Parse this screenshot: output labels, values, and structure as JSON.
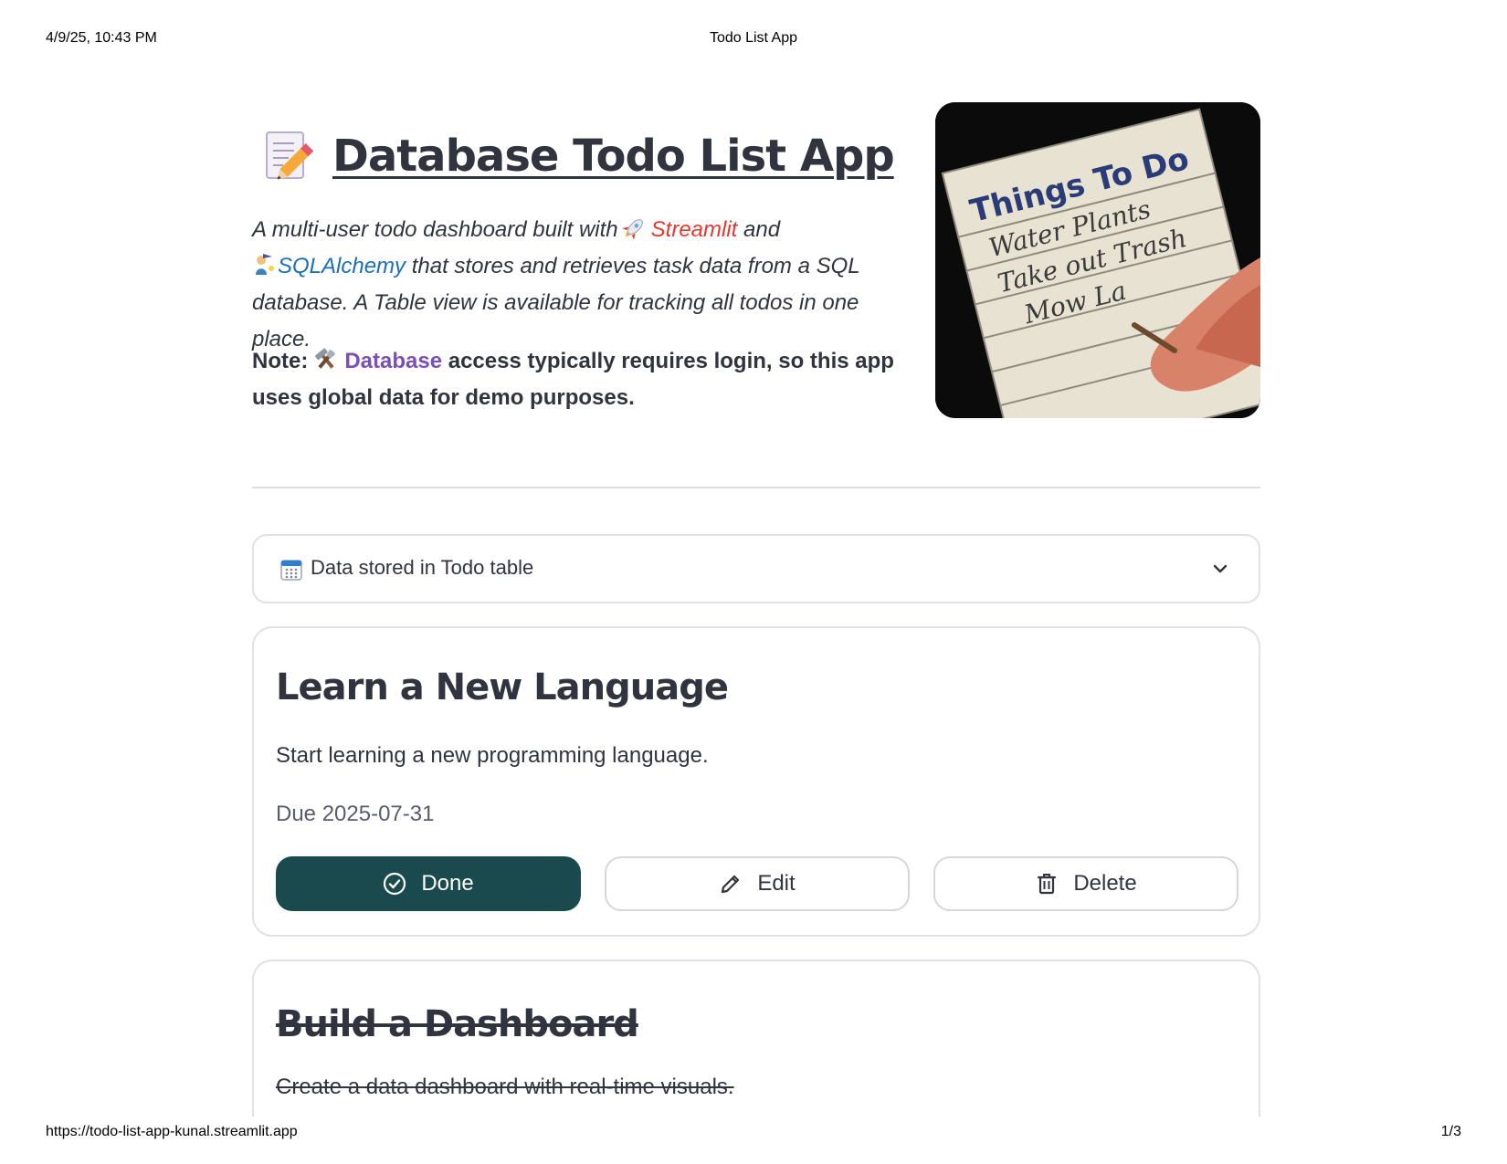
{
  "print": {
    "datetime": "4/9/25, 10:43 PM",
    "page_title": "Todo List App",
    "url": "https://todo-list-app-kunal.streamlit.app",
    "page_number": "1/3"
  },
  "header": {
    "title": "Database Todo List App",
    "title_icon": "memo-icon",
    "subtitle": {
      "part1": "A multi-user todo dashboard built with",
      "streamlit_link": "Streamlit",
      "and": "and",
      "sqlalchemy_link": "SQLAlchemy",
      "part2": "that stores and retrieves task data from a SQL database. A Table view is available for tracking all todos in one place."
    },
    "note": {
      "prefix": "Note:",
      "database_link": "Database",
      "text": "access typically requires login, so this app uses global data for demo purposes."
    },
    "image": {
      "heading": "Things To Do",
      "items": [
        "Water Plants",
        "Take out Trash",
        "Mow La"
      ]
    }
  },
  "expander": {
    "label": "Data stored in Todo table",
    "icon": "calendar-icon",
    "expanded": false
  },
  "todos": [
    {
      "title": "Learn a New Language",
      "description": "Start learning a new programming language.",
      "due": "Due 2025-07-31",
      "done": false
    },
    {
      "title": "Build a Dashboard",
      "description": "Create a data dashboard with real-time visuals.",
      "done": true
    }
  ],
  "buttons": {
    "done": "Done",
    "edit": "Edit",
    "delete": "Delete"
  },
  "colors": {
    "text": "#31333f",
    "done_button": "#1a4a4e",
    "streamlit_link": "#e8372f",
    "sqlalchemy_link": "#1c6fb8",
    "database_link": "#7b4fb5"
  }
}
